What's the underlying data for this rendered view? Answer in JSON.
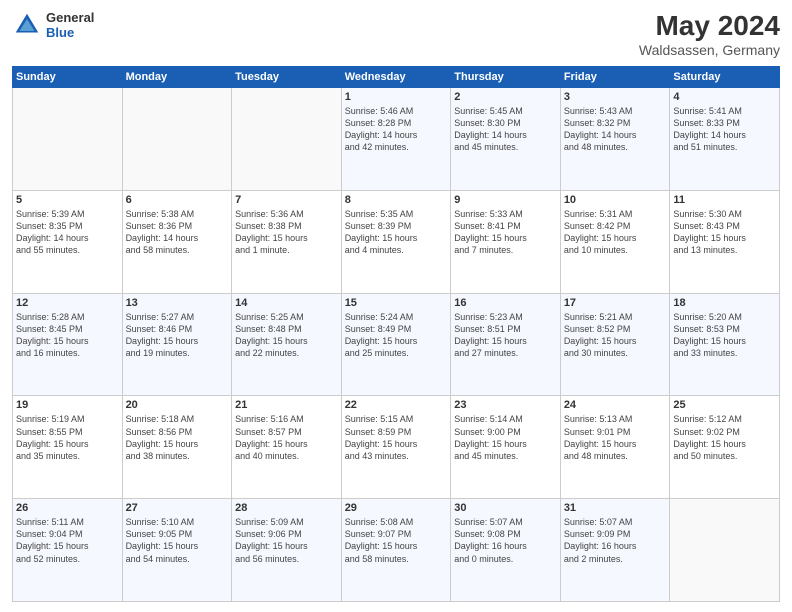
{
  "header": {
    "logo": {
      "general": "General",
      "blue": "Blue"
    },
    "title": "May 2024",
    "location": "Waldsassen, Germany"
  },
  "days_of_week": [
    "Sunday",
    "Monday",
    "Tuesday",
    "Wednesday",
    "Thursday",
    "Friday",
    "Saturday"
  ],
  "weeks": [
    [
      {
        "day": "",
        "content": ""
      },
      {
        "day": "",
        "content": ""
      },
      {
        "day": "",
        "content": ""
      },
      {
        "day": "1",
        "content": "Sunrise: 5:46 AM\nSunset: 8:28 PM\nDaylight: 14 hours\nand 42 minutes."
      },
      {
        "day": "2",
        "content": "Sunrise: 5:45 AM\nSunset: 8:30 PM\nDaylight: 14 hours\nand 45 minutes."
      },
      {
        "day": "3",
        "content": "Sunrise: 5:43 AM\nSunset: 8:32 PM\nDaylight: 14 hours\nand 48 minutes."
      },
      {
        "day": "4",
        "content": "Sunrise: 5:41 AM\nSunset: 8:33 PM\nDaylight: 14 hours\nand 51 minutes."
      }
    ],
    [
      {
        "day": "5",
        "content": "Sunrise: 5:39 AM\nSunset: 8:35 PM\nDaylight: 14 hours\nand 55 minutes."
      },
      {
        "day": "6",
        "content": "Sunrise: 5:38 AM\nSunset: 8:36 PM\nDaylight: 14 hours\nand 58 minutes."
      },
      {
        "day": "7",
        "content": "Sunrise: 5:36 AM\nSunset: 8:38 PM\nDaylight: 15 hours\nand 1 minute."
      },
      {
        "day": "8",
        "content": "Sunrise: 5:35 AM\nSunset: 8:39 PM\nDaylight: 15 hours\nand 4 minutes."
      },
      {
        "day": "9",
        "content": "Sunrise: 5:33 AM\nSunset: 8:41 PM\nDaylight: 15 hours\nand 7 minutes."
      },
      {
        "day": "10",
        "content": "Sunrise: 5:31 AM\nSunset: 8:42 PM\nDaylight: 15 hours\nand 10 minutes."
      },
      {
        "day": "11",
        "content": "Sunrise: 5:30 AM\nSunset: 8:43 PM\nDaylight: 15 hours\nand 13 minutes."
      }
    ],
    [
      {
        "day": "12",
        "content": "Sunrise: 5:28 AM\nSunset: 8:45 PM\nDaylight: 15 hours\nand 16 minutes."
      },
      {
        "day": "13",
        "content": "Sunrise: 5:27 AM\nSunset: 8:46 PM\nDaylight: 15 hours\nand 19 minutes."
      },
      {
        "day": "14",
        "content": "Sunrise: 5:25 AM\nSunset: 8:48 PM\nDaylight: 15 hours\nand 22 minutes."
      },
      {
        "day": "15",
        "content": "Sunrise: 5:24 AM\nSunset: 8:49 PM\nDaylight: 15 hours\nand 25 minutes."
      },
      {
        "day": "16",
        "content": "Sunrise: 5:23 AM\nSunset: 8:51 PM\nDaylight: 15 hours\nand 27 minutes."
      },
      {
        "day": "17",
        "content": "Sunrise: 5:21 AM\nSunset: 8:52 PM\nDaylight: 15 hours\nand 30 minutes."
      },
      {
        "day": "18",
        "content": "Sunrise: 5:20 AM\nSunset: 8:53 PM\nDaylight: 15 hours\nand 33 minutes."
      }
    ],
    [
      {
        "day": "19",
        "content": "Sunrise: 5:19 AM\nSunset: 8:55 PM\nDaylight: 15 hours\nand 35 minutes."
      },
      {
        "day": "20",
        "content": "Sunrise: 5:18 AM\nSunset: 8:56 PM\nDaylight: 15 hours\nand 38 minutes."
      },
      {
        "day": "21",
        "content": "Sunrise: 5:16 AM\nSunset: 8:57 PM\nDaylight: 15 hours\nand 40 minutes."
      },
      {
        "day": "22",
        "content": "Sunrise: 5:15 AM\nSunset: 8:59 PM\nDaylight: 15 hours\nand 43 minutes."
      },
      {
        "day": "23",
        "content": "Sunrise: 5:14 AM\nSunset: 9:00 PM\nDaylight: 15 hours\nand 45 minutes."
      },
      {
        "day": "24",
        "content": "Sunrise: 5:13 AM\nSunset: 9:01 PM\nDaylight: 15 hours\nand 48 minutes."
      },
      {
        "day": "25",
        "content": "Sunrise: 5:12 AM\nSunset: 9:02 PM\nDaylight: 15 hours\nand 50 minutes."
      }
    ],
    [
      {
        "day": "26",
        "content": "Sunrise: 5:11 AM\nSunset: 9:04 PM\nDaylight: 15 hours\nand 52 minutes."
      },
      {
        "day": "27",
        "content": "Sunrise: 5:10 AM\nSunset: 9:05 PM\nDaylight: 15 hours\nand 54 minutes."
      },
      {
        "day": "28",
        "content": "Sunrise: 5:09 AM\nSunset: 9:06 PM\nDaylight: 15 hours\nand 56 minutes."
      },
      {
        "day": "29",
        "content": "Sunrise: 5:08 AM\nSunset: 9:07 PM\nDaylight: 15 hours\nand 58 minutes."
      },
      {
        "day": "30",
        "content": "Sunrise: 5:07 AM\nSunset: 9:08 PM\nDaylight: 16 hours\nand 0 minutes."
      },
      {
        "day": "31",
        "content": "Sunrise: 5:07 AM\nSunset: 9:09 PM\nDaylight: 16 hours\nand 2 minutes."
      },
      {
        "day": "",
        "content": ""
      }
    ]
  ]
}
